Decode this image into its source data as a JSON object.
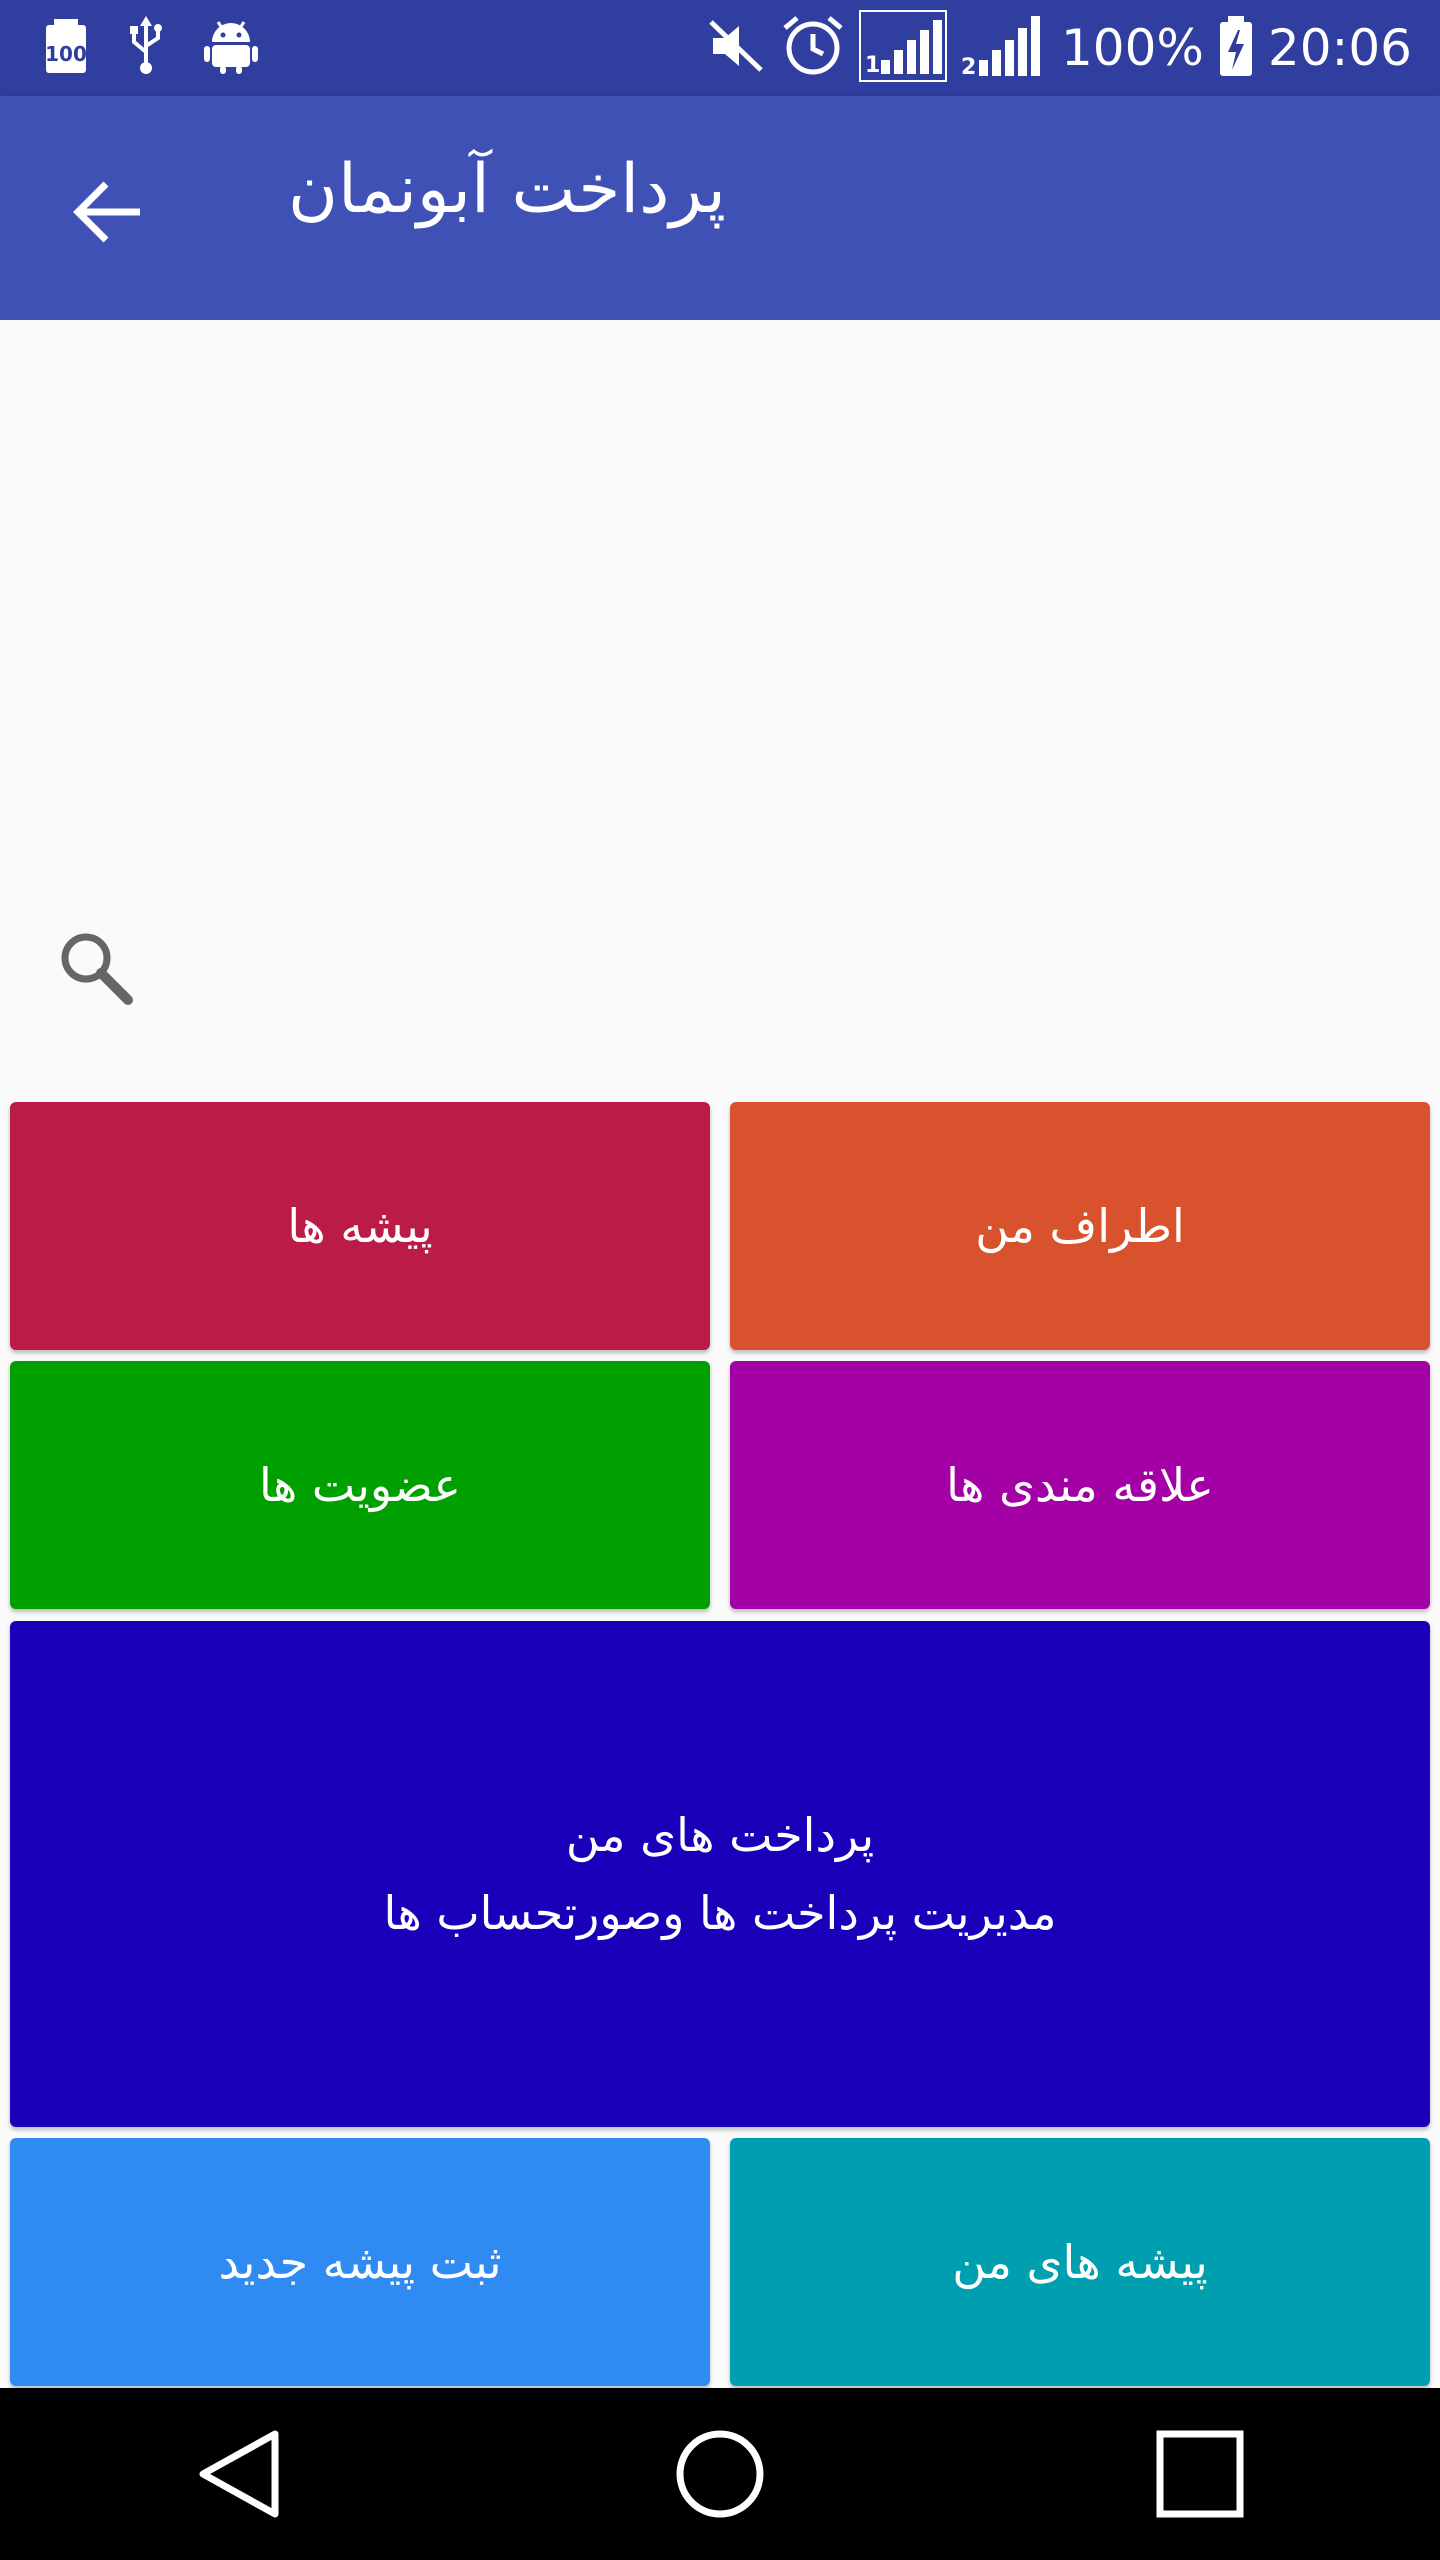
{
  "status_bar": {
    "time": "20:06",
    "battery_text": "100%",
    "icons_left": [
      "battery-100-notification-icon",
      "usb-icon",
      "android-debug-icon"
    ],
    "icons_right": [
      "mute-icon",
      "alarm-icon",
      "sim1-signal-icon",
      "sim2-signal-icon",
      "battery-charging-icon"
    ],
    "background": "#303f9f"
  },
  "app_bar": {
    "title": "پرداخت آبونمان",
    "back_icon": "arrow-back-icon",
    "background": "#3f51b5"
  },
  "search": {
    "icon": "search-icon"
  },
  "tiles": {
    "around_me": {
      "label": "اطراف من",
      "color": "#d9522e"
    },
    "professions": {
      "label": "پیشه ها",
      "color": "#bb1c47"
    },
    "favorites": {
      "label": "علاقه مندی ها",
      "color": "#a300a6"
    },
    "memberships": {
      "label": "عضویت ها",
      "color": "#00a000"
    },
    "my_payments": {
      "label": "پرداخت های من",
      "sublabel": "مدیریت پرداخت ها وصورتحساب ها",
      "color": "#1b00ba"
    },
    "my_professions": {
      "label": "پیشه های من",
      "color": "#009faf"
    },
    "new_profession": {
      "label": "ثبت پیشه جدید",
      "color": "#2f8af1"
    }
  },
  "nav_bar": {
    "icons": [
      "nav-back-icon",
      "nav-home-icon",
      "nav-recents-icon"
    ]
  }
}
